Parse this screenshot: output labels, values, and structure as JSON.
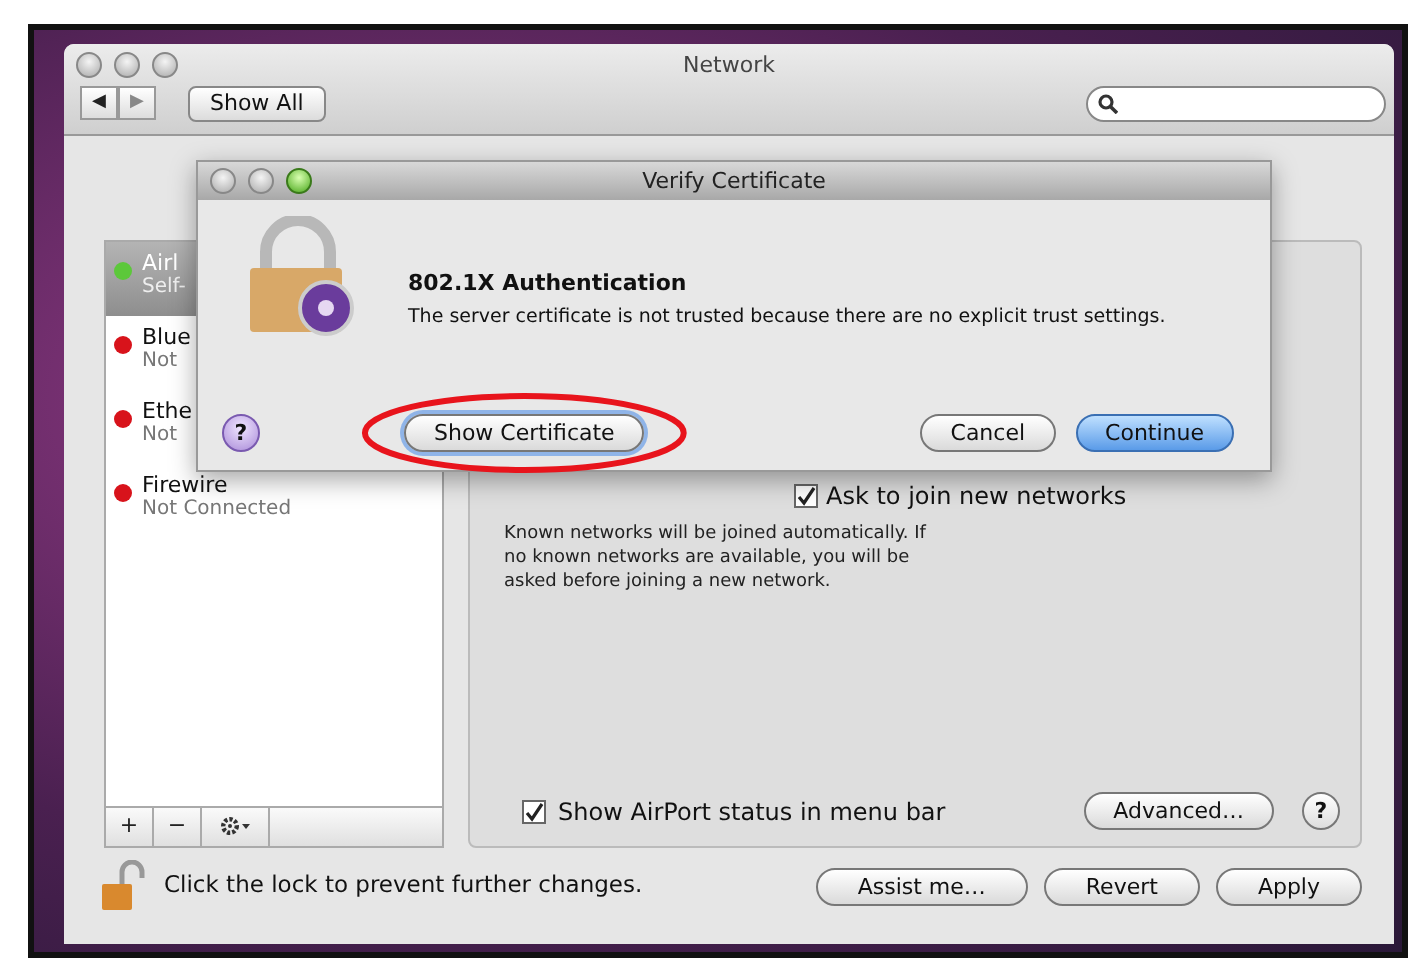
{
  "window": {
    "title": "Network",
    "back": "◀",
    "forward": "▶",
    "show_all": "Show All"
  },
  "sidebar": {
    "items": [
      {
        "name": "Airl",
        "status": "Self-",
        "color": "#5cc83a",
        "selected": true
      },
      {
        "name": "Blue",
        "status": "Not",
        "color": "#d8131b",
        "selected": false
      },
      {
        "name": "Ethe",
        "status": "Not",
        "color": "#d8131b",
        "selected": false
      },
      {
        "name": "Firewire",
        "status": "Not Connected",
        "color": "#d8131b",
        "selected": false
      }
    ],
    "tools": [
      "+",
      "−"
    ]
  },
  "panel": {
    "ask_to_join": {
      "label": "Ask to join new networks",
      "checked": true,
      "description": "Known networks will be joined automatically. If no known networks are available, you will be asked before joining a new network."
    },
    "show_status": {
      "label": "Show AirPort status in menu bar",
      "checked": true
    },
    "advanced": "Advanced…",
    "help": "?"
  },
  "footer": {
    "lock_text": "Click the lock to prevent further changes.",
    "buttons": [
      "Assist me…",
      "Revert",
      "Apply"
    ]
  },
  "dialog": {
    "title": "Verify Certificate",
    "heading": "802.1X Authentication",
    "message": "The server certificate is not trusted because there are no explicit trust settings.",
    "help": "?",
    "buttons": [
      {
        "label": "Show Certificate",
        "kind": "plain",
        "highlighted": true
      },
      {
        "label": "Cancel",
        "kind": "plain",
        "highlighted": false
      },
      {
        "label": "Continue",
        "kind": "default",
        "highlighted": false
      }
    ]
  }
}
